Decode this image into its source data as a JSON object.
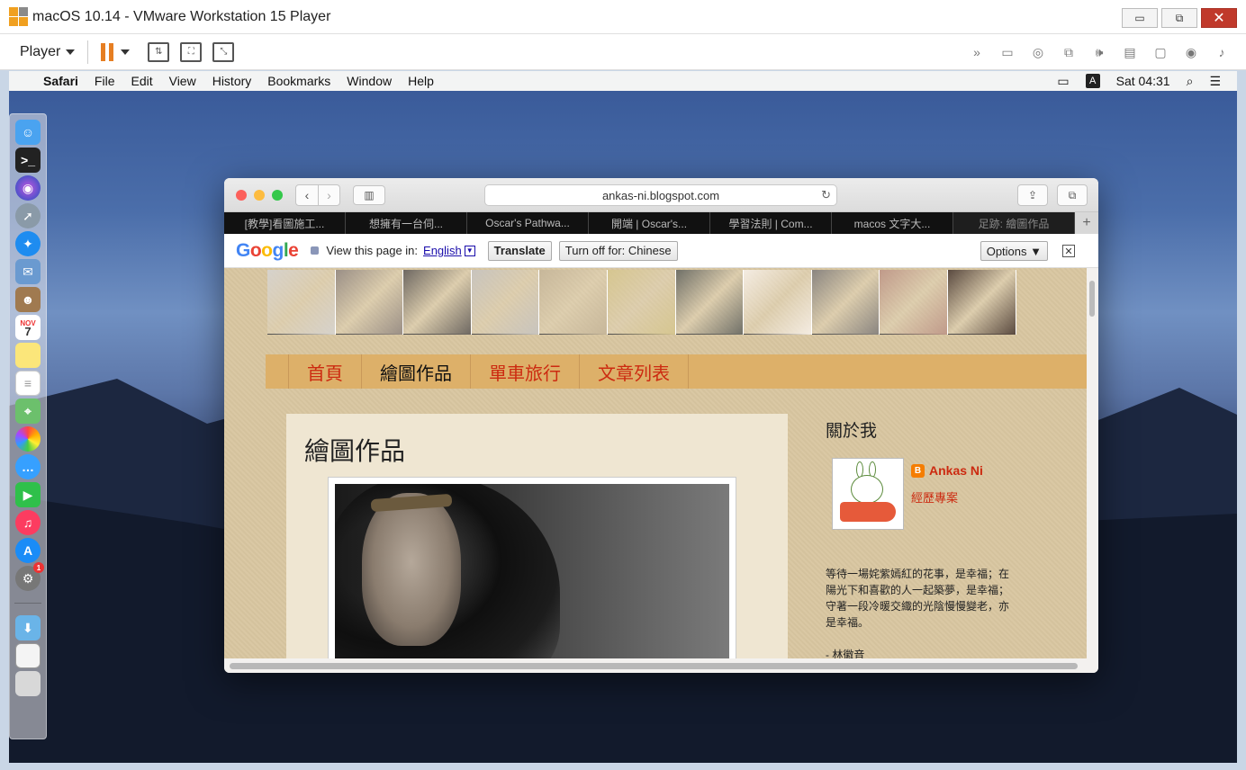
{
  "vmware": {
    "title": "macOS 10.14 - VMware Workstation 15 Player",
    "player_menu": "Player",
    "window_buttons": {
      "minimize": "▭",
      "restore": "⧉",
      "close": "✕"
    }
  },
  "mac_menubar": {
    "app_name": "Safari",
    "items": [
      "File",
      "Edit",
      "View",
      "History",
      "Bookmarks",
      "Window",
      "Help"
    ],
    "input_indicator": "A",
    "clock": "Sat 04:31"
  },
  "dock": {
    "calendar_month": "NOV",
    "calendar_day": "7",
    "badge": "1"
  },
  "safari": {
    "url": "ankas-ni.blogspot.com",
    "tabs": [
      "[教學]看圖施工...",
      "想擁有一台伺...",
      "Oscar's Pathwa...",
      "開端 | Oscar's...",
      "學習法則 | Com...",
      "macos 文字大...",
      "足跡: 繪圖作品"
    ],
    "tab_add": "+"
  },
  "translate_bar": {
    "logo_letters": [
      "G",
      "o",
      "o",
      "g",
      "l",
      "e"
    ],
    "prompt": "View this page in:",
    "language": "English",
    "translate_button": "Translate",
    "turn_off_button": "Turn off for: Chinese",
    "options_button": "Options ▼",
    "close": "✕"
  },
  "blog": {
    "nav": [
      "首頁",
      "繪圖作品",
      "單車旅行",
      "文章列表"
    ],
    "post_title": "繪圖作品",
    "sidebar": {
      "title": "關於我",
      "profile_name": "Ankas Ni",
      "profile_link": "經歷專案",
      "about_text": "等待一場姹紫嫣紅的花事，是幸福；在陽光下和喜歡的人一起築夢，是幸福；守著一段冷暖交織的光陰慢慢變老，亦是幸福。",
      "signature": "- 林徽音"
    },
    "banner_colors": [
      "#d6d2cc",
      "#9a8f86",
      "#6e6862",
      "#c8c4be",
      "#c7b79a",
      "#d6c690",
      "#707068",
      "#f4ece2",
      "#8a8580",
      "#c09a8a",
      "#5a4a40"
    ]
  }
}
